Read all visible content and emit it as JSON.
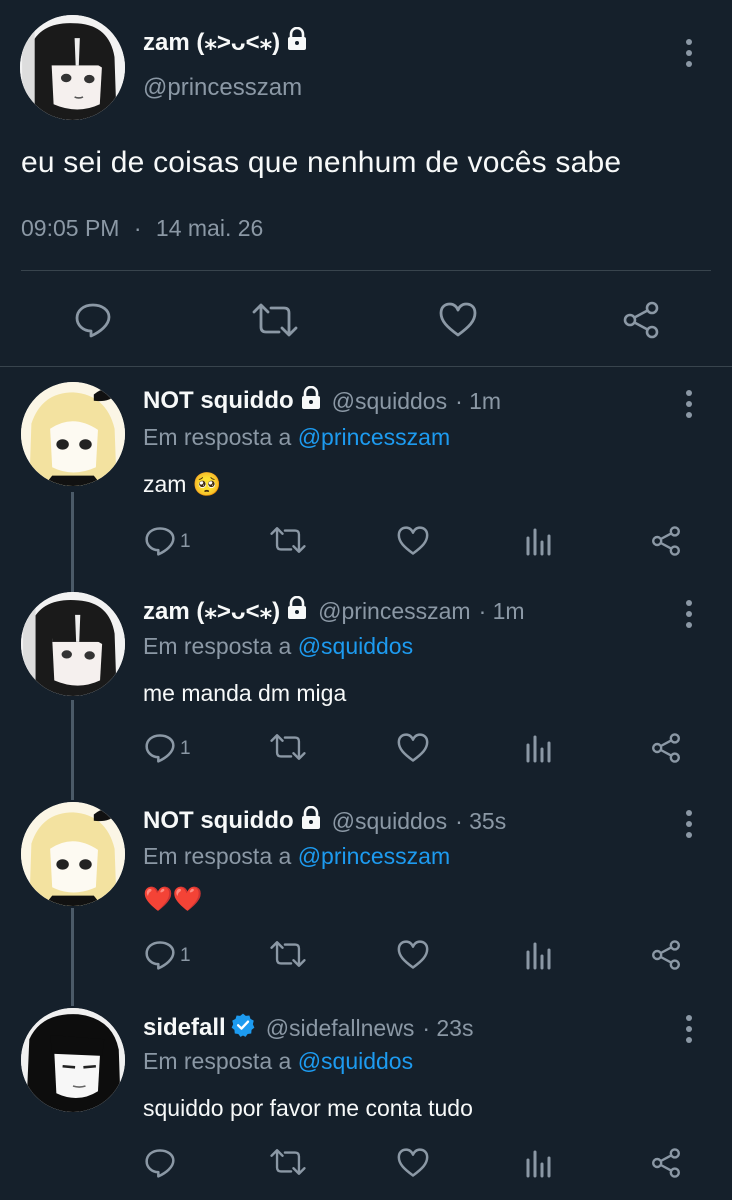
{
  "main_tweet": {
    "display_name": "zam (⁎˃ᴗ˂⁎)",
    "handle": "@princesszam",
    "text": "eu sei de coisas que nenhum de vocês sabe",
    "time": "09:05 PM",
    "separator": "·",
    "date": "14 mai. 26"
  },
  "replies": [
    {
      "display_name": "NOT squiddo",
      "handle": "@squiddos",
      "age": "· 1m",
      "reply_prefix": "Em resposta a",
      "reply_to": "@princesszam",
      "text": "zam 🥺",
      "reply_count": "1",
      "locked": true
    },
    {
      "display_name": "zam (⁎˃ᴗ˂⁎)",
      "handle": "@princesszam",
      "age": "· 1m",
      "reply_prefix": "Em resposta a",
      "reply_to": "@squiddos",
      "text": "me manda dm miga",
      "reply_count": "1",
      "locked": true
    },
    {
      "display_name": "NOT squiddo",
      "handle": "@squiddos",
      "age": "· 35s",
      "reply_prefix": "Em resposta a",
      "reply_to": "@princesszam",
      "text": "❤️❤️",
      "reply_count": "1",
      "locked": true
    },
    {
      "display_name": "sidefall",
      "handle": "@sidefallnews",
      "age": "· 23s",
      "reply_prefix": "Em resposta a",
      "reply_to": "@squiddos",
      "text": "squiddo por favor me conta tudo",
      "reply_count": "",
      "verified": true
    }
  ],
  "colors": {
    "background": "#15202b",
    "text": "#e7e9ea",
    "muted": "#8b98a5",
    "link": "#1d9bf0",
    "verified": "#1d9bf0",
    "divider": "#38444d"
  },
  "icons": [
    "more-options-icon",
    "reply-icon",
    "retweet-icon",
    "like-icon",
    "analytics-icon",
    "share-icon",
    "lock-icon",
    "verified-badge-icon"
  ]
}
